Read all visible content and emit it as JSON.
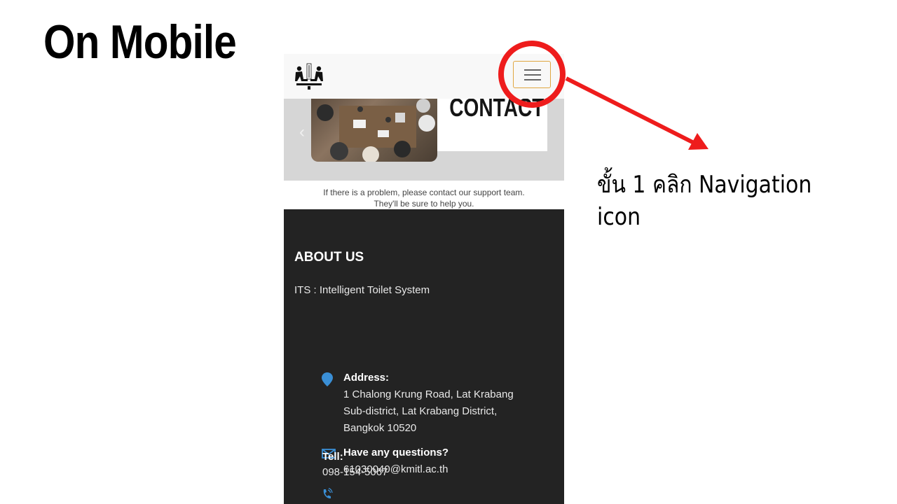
{
  "slide": {
    "title": "On Mobile"
  },
  "navbar": {
    "logo_label": "Intelligent Toilet System logo"
  },
  "banner": {
    "word": "CONTACT",
    "prev_glyph": "‹"
  },
  "support": {
    "line1": "If there is a problem, please contact our support team.",
    "line2": "They'll be sure to help you."
  },
  "footer": {
    "about_title": "ABOUT US",
    "about_sub": "ITS : Intelligent Toilet System",
    "address_label": "Address:",
    "address_lines": [
      "1 Chalong Krung Road, Lat Krabang",
      "Sub-district, Lat Krabang District,",
      "Bangkok 10520"
    ],
    "questions_label": "Have any questions?",
    "email": "61030040@kmitl.ac.th",
    "tell_label": "Tell:",
    "phone": "098-154-5067"
  },
  "annotation": {
    "text": "ขั้น 1 คลิก Navigation icon"
  },
  "colors": {
    "highlight": "#ee1c1c",
    "toggler_border": "#e0a640",
    "footer_bg": "#232323",
    "icon_blue": "#3a8fd6"
  }
}
